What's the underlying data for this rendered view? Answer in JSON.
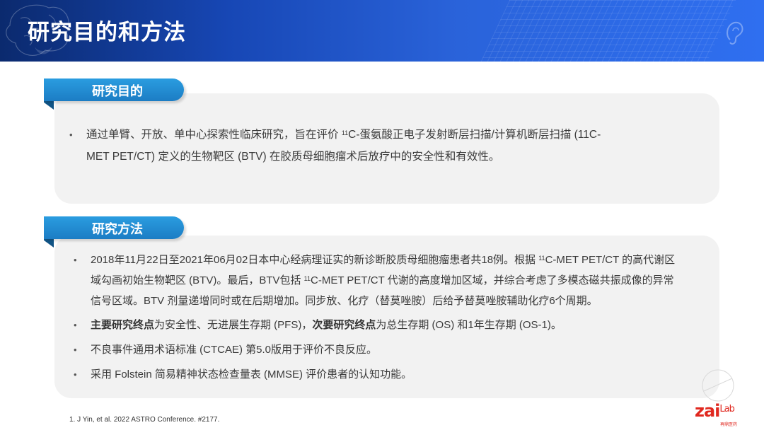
{
  "header": {
    "title": "研究目的和方法"
  },
  "section_objective": {
    "tab_label": "研究目的",
    "bullets": [
      {
        "line1_pre": "通过单臂、开放、单中心探索性临床研究，旨在评价 ",
        "sup": "11",
        "line1_post": "C-蛋氨酸正电子发射断层扫描/计算机断层扫描 (11C-",
        "line2": "MET PET/CT) 定义的生物靶区 (BTV) 在胶质母细胞瘤术后放疗中的安全性和有效性。"
      }
    ]
  },
  "section_methods": {
    "tab_label": "研究方法",
    "bullet1": {
      "l1_pre": "2018年11月22日至2021年06月02日本中心经病理证实的新诊断胶质母细胞瘤患者共18例。根据 ",
      "l1_sup": "11",
      "l1_post": "C-MET PET/CT 的高代谢区",
      "l2_pre": "域勾画初始生物靶区 (BTV)。最后，BTV包括 ",
      "l2_sup": "11",
      "l2_post": "C-MET PET/CT 代谢的高度增加区域，并综合考虑了多模态磁共振成像的异常",
      "l3": "信号区域。BTV 剂量递增同时或在后期增加。同步放、化疗（替莫唑胺）后给予替莫唑胺辅助化疗6个周期。"
    },
    "bullet2": {
      "bold1": "主要研究终点",
      "text1": "为安全性、无进展生存期 (PFS)，",
      "bold2": "次要研究终点",
      "text2": "为总生存期 (OS) 和1年生存期 (OS-1)。"
    },
    "bullet3": "不良事件通用术语标准 (CTCAE) 第5.0版用于评价不良反应。",
    "bullet4": "采用 Folstein 简易精神状态检查量表 (MMSE) 评价患者的认知功能。"
  },
  "footer": {
    "footnote": "1.   J Yin, et al. 2022 ASTRO Conference. #2177.",
    "logo_main": "zai",
    "logo_lab": "Lab",
    "logo_sub": "再鼎医药"
  },
  "bullet_symbol": "•",
  "colors": {
    "header_dark": "#0b2a6e",
    "header_light": "#2f6ff0",
    "tab_blue": "#1c7dc4",
    "panel_bg": "#f2f2f2",
    "logo_red": "#e0281f"
  },
  "icons": [
    "brain-icon",
    "ear-icon",
    "lips-icon"
  ]
}
